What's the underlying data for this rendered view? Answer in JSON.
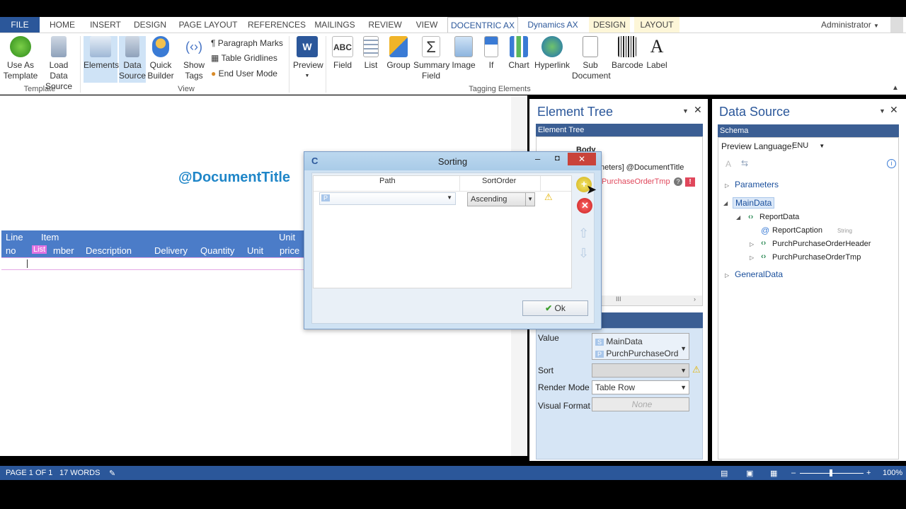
{
  "ribbon_tabs": [
    "FILE",
    "HOME",
    "INSERT",
    "DESIGN",
    "PAGE LAYOUT",
    "REFERENCES",
    "MAILINGS",
    "REVIEW",
    "VIEW",
    "DOCENTRIC AX",
    "Dynamics AX",
    "DESIGN",
    "LAYOUT"
  ],
  "user": "Administrator",
  "ribbon": {
    "template_group": "Template",
    "view_group": "View",
    "tagging_group": "Tagging Elements",
    "use_as_template": [
      "Use As",
      "Template"
    ],
    "load_data_source": [
      "Load Data",
      "Source"
    ],
    "elements": "Elements",
    "data_source": [
      "Data",
      "Source"
    ],
    "quick_builder": [
      "Quick",
      "Builder"
    ],
    "show_tags": [
      "Show",
      "Tags"
    ],
    "paragraph_marks": "Paragraph Marks",
    "table_gridlines": "Table Gridlines",
    "end_user_mode": "End User Mode",
    "preview": "Preview",
    "field": "Field",
    "list": "List",
    "group": "Group",
    "summary_field": [
      "Summary",
      "Field"
    ],
    "image": "Image",
    "if": "If",
    "chart": "Chart",
    "hyperlink": "Hyperlink",
    "sub_document": [
      "Sub",
      "Document"
    ],
    "barcode": "Barcode",
    "label": "Label"
  },
  "document": {
    "title_tag": "@DocumentTitle",
    "columns": {
      "line_no": [
        "Line",
        "no"
      ],
      "item_number": [
        "Item",
        "mber"
      ],
      "list_tag": "List",
      "description": "Description",
      "delivery": "Delivery",
      "quantity": "Quantity",
      "unit": "Unit",
      "unit_price": [
        "Unit",
        "price"
      ]
    }
  },
  "element_tree": {
    "title": "Element Tree",
    "header": "Element Tree",
    "body_node": "Body",
    "node_doc_title": "neters] @DocumentTitle",
    "node_purch": "PurchaseOrderTmp",
    "scroll_label": "III"
  },
  "properties": {
    "value_label": "Value",
    "value_line1": "MainData",
    "value_line2": "PurchPurchaseOrd",
    "sort_label": "Sort",
    "render_mode_label": "Render Mode",
    "render_mode_value": "Table Row",
    "visual_format_label": "Visual Format",
    "visual_format_value": "None"
  },
  "data_source": {
    "title": "Data Source",
    "header": "Schema",
    "preview_language_label": "Preview Language:",
    "preview_language_value": "ENU",
    "nodes": {
      "parameters": "Parameters",
      "maindata": "MainData",
      "reportdata": "ReportData",
      "reportcaption": "ReportCaption",
      "reportcaption_type": "String",
      "header": "PurchPurchaseOrderHeader",
      "tmp": "PurchPurchaseOrderTmp",
      "generaldata": "GeneralData"
    }
  },
  "dialog": {
    "title": "Sorting",
    "col_path": "Path",
    "col_sortorder": "SortOrder",
    "sortorder_value": "Ascending",
    "ok_label": "Ok"
  },
  "status": {
    "page": "PAGE 1 OF 1",
    "words": "17 WORDS",
    "zoom": "100%"
  },
  "colors": {
    "accent": "#2b579a",
    "header_blue": "#4b7cc8",
    "title_blue": "#1f86c8"
  }
}
